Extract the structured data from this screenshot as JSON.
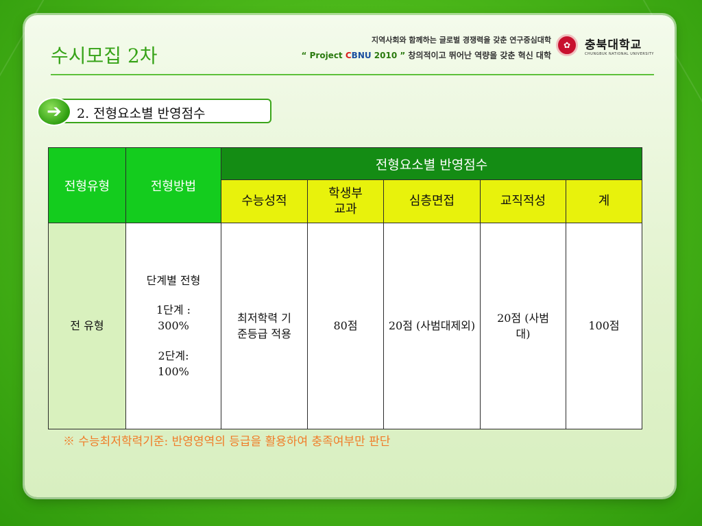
{
  "header": {
    "title": "수시모집 2차",
    "slogan_line1": "지역사회와 함께하는 글로벌 경쟁력을 갖춘 연구중심대학",
    "slogan_project_quote_open": "“ Project ",
    "slogan_c": "C",
    "slogan_bnu": "BNU",
    "slogan_year": " 2010 ”",
    "slogan_line2_rest": " 창의적이고 뛰어난 역량을 갖춘 혁신 대학",
    "logo_korean": "충북대학교",
    "logo_english": "CHUNGBUK NATIONAL UNIVERSITY"
  },
  "section": {
    "label": "2. 전형요소별 반영점수",
    "icon": "arrow-right-icon"
  },
  "table": {
    "headers": {
      "type": "전형유형",
      "method": "전형방법",
      "group": "전형요소별 반영점수",
      "sub": [
        "수능성적",
        "학생부 교과",
        "심층면접",
        "교직적성",
        "계"
      ]
    },
    "row": {
      "type": "전 유형",
      "method_title": "단계별 전형",
      "method_stage1": "1단계 : 300%",
      "method_stage2": "2단계: 100%",
      "suneung": "최저학력 기준등급 적용",
      "school_record": "80점",
      "interview": "20점 (사범대제외)",
      "teaching": "20점 (사범대)",
      "total": "100점"
    }
  },
  "note": "※ 수능최저학력기준: 반영영역의 등급을 활용하여 충족여부만 판단",
  "colors": {
    "accent_green": "#37a318",
    "header_dark_green": "#148c14",
    "header_bright_green": "#14cc1e",
    "header_yellow": "#e8f20c",
    "note_orange": "#f07c28"
  }
}
